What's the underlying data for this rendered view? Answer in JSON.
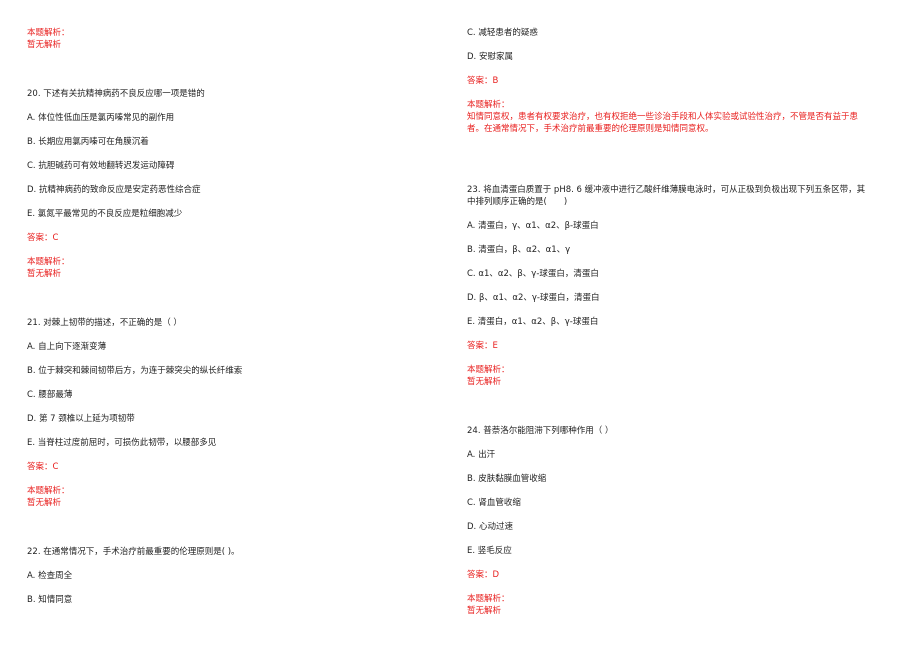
{
  "labels": {
    "analysis_title": "本题解析：",
    "no_analysis": "暂无解析",
    "answer_prefix": "答案："
  },
  "left_column": {
    "prev_analysis": {
      "title": "本题解析：",
      "text": "暂无解析"
    },
    "questions": [
      {
        "number": "20",
        "stem": "20. 下述有关抗精神病药不良反应哪一项是错的",
        "options": [
          "A. 体位性低血压是氯丙嗪常见的副作用",
          "B. 长期应用氯丙嗪可在角膜沉着",
          "C. 抗胆碱药可有效地翻转迟发运动障碍",
          "D. 抗精神病药的致命反应是安定药恶性综合症",
          "E. 氯氮平最常见的不良反应是粒细胞减少"
        ],
        "answer": "答案：C",
        "analysis_title": "本题解析：",
        "analysis": "暂无解析"
      },
      {
        "number": "21",
        "stem": "21. 对棘上韧带的描述，不正确的是（ ）",
        "options": [
          "A. 自上向下逐渐变薄",
          "B. 位于棘突和棘间韧带后方，为连于棘突尖的纵长纤维索",
          "C. 腰部最薄",
          "D. 第 7 颈椎以上延为项韧带",
          "E. 当脊柱过度前屈时，可损伤此韧带，以腰部多见"
        ],
        "answer": "答案：C",
        "analysis_title": "本题解析：",
        "analysis": "暂无解析"
      },
      {
        "number": "22",
        "stem": "22. 在通常情况下，手术治疗前最重要的伦理原则是( )。",
        "options": [
          "A. 检查周全",
          "B. 知情同意"
        ]
      }
    ]
  },
  "right_column": {
    "q22_continued": {
      "options": [
        "C. 减轻患者的疑惑",
        "D. 安慰家属"
      ],
      "answer": "答案：B",
      "analysis_title": "本题解析：",
      "analysis_line1": "知情同意权，患者有权要求治疗，也有权拒绝一些诊治手段和人体实验或试验性治疗，不管是否有益于患",
      "analysis_line2": "者。在通常情况下，手术治疗前最重要的伦理原则是知情同意权。"
    },
    "questions": [
      {
        "number": "23",
        "stem_line1": "23. 将血清蛋白质置于 pH8. 6 缓冲液中进行乙酸纤维薄膜电泳时，可从正极到负极出现下列五条区带，其",
        "stem_line2": "中排列顺序正确的是(　　)",
        "options": [
          "A. 清蛋白，γ、α1、α2、β-球蛋白",
          "B. 清蛋白，β、α2、α1、γ",
          "C. α1、α2、β、γ-球蛋白，清蛋白",
          "D. β、α1、α2、γ-球蛋白，清蛋白",
          "E. 清蛋白，α1、α2、β、γ-球蛋白"
        ],
        "answer": "答案：E",
        "analysis_title": "本题解析：",
        "analysis": "暂无解析"
      },
      {
        "number": "24",
        "stem": "24. 普萘洛尔能阻滞下列哪种作用（ ）",
        "options": [
          "A. 出汗",
          "B. 皮肤黏膜血管收缩",
          "C. 肾血管收缩",
          "D. 心动过速",
          "E. 竖毛反应"
        ],
        "answer": "答案：D",
        "analysis_title": "本题解析：",
        "analysis": "暂无解析"
      }
    ]
  },
  "colors": {
    "text": "#222222",
    "accent_red": "#e8201f",
    "background": "#ffffff"
  }
}
